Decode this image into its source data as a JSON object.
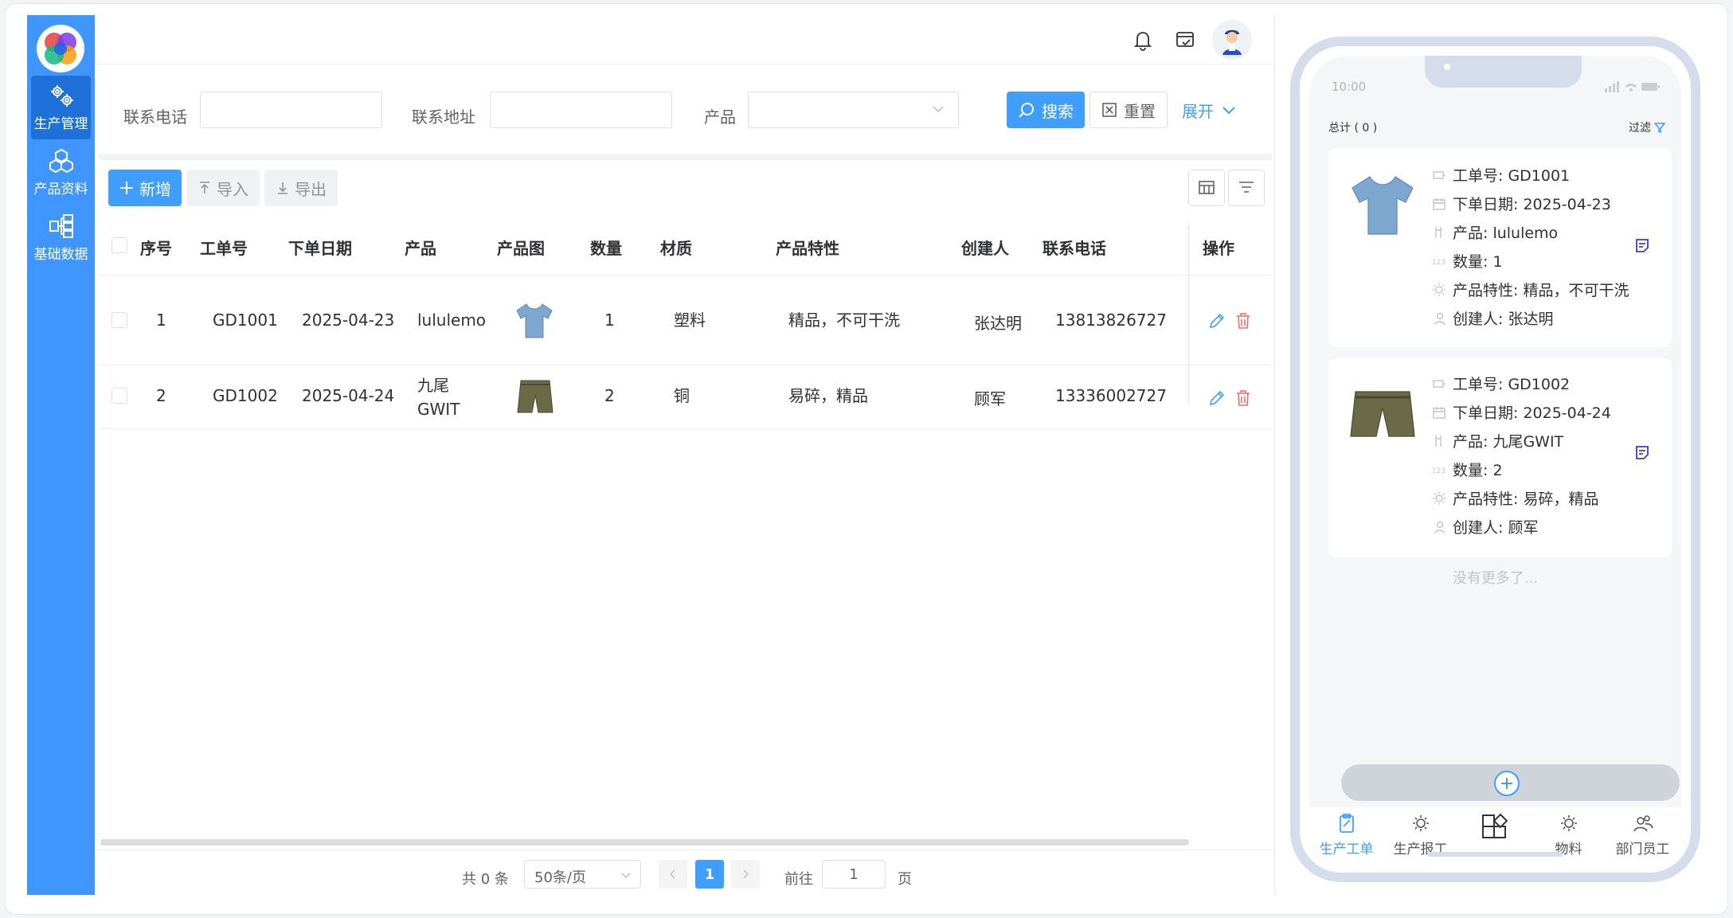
{
  "sidebar": {
    "items": [
      {
        "label": "生产管理",
        "icon": "gears-icon",
        "active": true
      },
      {
        "label": "产品资料",
        "icon": "cubes-icon",
        "active": false
      },
      {
        "label": "基础数据",
        "icon": "org-tree-icon",
        "active": false
      }
    ]
  },
  "header": {
    "icons": [
      "bell-icon",
      "note-check-icon",
      "fullscreen-icon"
    ],
    "avatar": "user-avatar"
  },
  "search": {
    "phone_label": "联系电话",
    "phone_value": "",
    "address_label": "联系地址",
    "address_value": "",
    "product_label": "产品",
    "product_value": "",
    "search_button": "搜索",
    "reset_button": "重置",
    "expand_link": "展开"
  },
  "toolbar": {
    "add": "新增",
    "import": "导入",
    "export": "导出"
  },
  "table": {
    "columns": [
      "序号",
      "工单号",
      "下单日期",
      "产品",
      "产品图",
      "数量",
      "材质",
      "产品特性",
      "创建人",
      "联系电话",
      "操作"
    ],
    "rows": [
      {
        "index": "1",
        "order_no": "GD1001",
        "date": "2025-04-23",
        "product": "lululemo",
        "product_line2": "",
        "image": "blue-tshirt",
        "qty": "1",
        "material": "塑料",
        "feature": "精品，不可干洗",
        "creator": "张达明",
        "phone": "13813826727"
      },
      {
        "index": "2",
        "order_no": "GD1002",
        "date": "2025-04-24",
        "product": "九尾",
        "product_line2": "GWIT",
        "image": "olive-shorts",
        "qty": "2",
        "material": "铜",
        "feature": "易碎，精品",
        "creator": "顾军",
        "phone": "13336002727"
      }
    ]
  },
  "pagination": {
    "total": "共 0 条",
    "page_size": "50条/页",
    "current_page": "1",
    "goto_label": "前往",
    "goto_value": "1",
    "page_suffix": "页"
  },
  "phone": {
    "time": "10:00",
    "summary": "总计 ( 0 )",
    "filter": "过滤",
    "cards": [
      {
        "order_label": "工单号: GD1001",
        "date_label": "下单日期: 2025-04-23",
        "product_label": "产品: lululemo",
        "qty_label": "数量: 1",
        "feature_label": "产品特性: 精品，不可干洗",
        "creator_label": "创建人: 张达明"
      },
      {
        "order_label": "工单号: GD1002",
        "date_label": "下单日期: 2025-04-24",
        "product_label": "产品: 九尾GWIT",
        "qty_label": "数量: 2",
        "feature_label": "产品特性: 易碎，精品",
        "creator_label": "创建人: 顾军"
      }
    ],
    "no_more": "没有更多了...",
    "tabs": [
      {
        "label": "生产工单",
        "icon": "clipboard-icon",
        "active": true
      },
      {
        "label": "生产报工",
        "icon": "sun-gear-icon",
        "active": false
      },
      {
        "label": "",
        "icon": "apps-grid-icon",
        "active": false
      },
      {
        "label": "物料",
        "icon": "sun-gear-icon",
        "active": false
      },
      {
        "label": "部门员工",
        "icon": "users-icon",
        "active": false
      }
    ]
  },
  "colors": {
    "primary": "#409eff",
    "sidebar": "#4096ff",
    "sidebar_active": "#1f70d8",
    "danger": "#f56c6c"
  }
}
